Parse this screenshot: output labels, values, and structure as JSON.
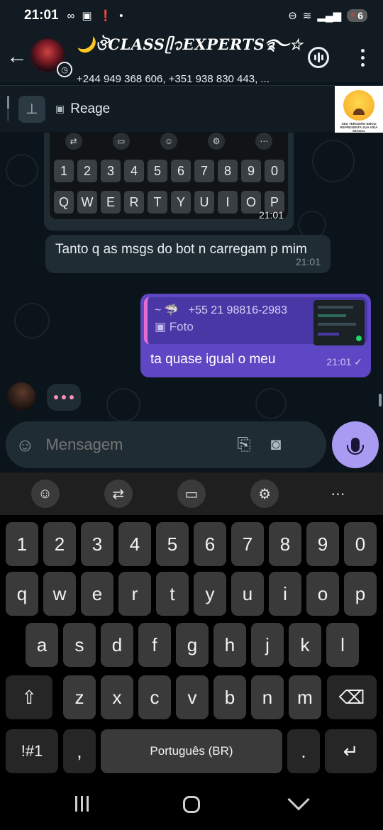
{
  "status_bar": {
    "time": "21:01",
    "battery": "6",
    "icons": [
      "voicemail-icon",
      "app-notification-icon",
      "alert-icon",
      "dot-icon",
      "dnd-icon",
      "wifi-icon",
      "signal-icon",
      "battery-icon"
    ]
  },
  "header": {
    "title": "🌙ঔCLASSᥫ᭡EXPERTS࿐☆🐙",
    "subtitle": "+244 949 368 606, +351 938 830 443, ..."
  },
  "pinned": {
    "text": "Reage",
    "thumb_caption": "SEU TERCEIRO EMOJI REPRESENTA SUA VIDA SEXUAL"
  },
  "messages": {
    "image_time": "21:01",
    "mini_keys_numbers": [
      "1",
      "2",
      "3",
      "4",
      "5",
      "6",
      "7",
      "8",
      "9",
      "0"
    ],
    "mini_keys_letters": [
      "Q",
      "W",
      "E",
      "R",
      "T",
      "Y",
      "U",
      "I",
      "O",
      "P"
    ],
    "incoming_text": "Tanto q as msgs do bot n carregam p mim",
    "incoming_time": "21:01",
    "reply_author": "~ 🦈",
    "reply_number": "+55 21 98816-2983",
    "reply_type": "Foto",
    "outgoing_text": "ta quase igual o meu",
    "outgoing_time": "21:01 ✓"
  },
  "composer": {
    "placeholder": "Mensagem"
  },
  "keyboard": {
    "numbers": [
      "1",
      "2",
      "3",
      "4",
      "5",
      "6",
      "7",
      "8",
      "9",
      "0"
    ],
    "row1": [
      "q",
      "w",
      "e",
      "r",
      "t",
      "y",
      "u",
      "i",
      "o",
      "p"
    ],
    "row2": [
      "a",
      "s",
      "d",
      "f",
      "g",
      "h",
      "j",
      "k",
      "l"
    ],
    "row3": [
      "z",
      "x",
      "c",
      "v",
      "b",
      "n",
      "m"
    ],
    "symbols_key": "!#1",
    "comma_key": ",",
    "space_label": "Português (BR)",
    "period_key": "."
  },
  "colors": {
    "outgoing_bubble": "#5e47c4",
    "incoming_bubble": "#1f2c34",
    "mic_button": "#a99bf2",
    "chat_bg": "#0b141a"
  }
}
